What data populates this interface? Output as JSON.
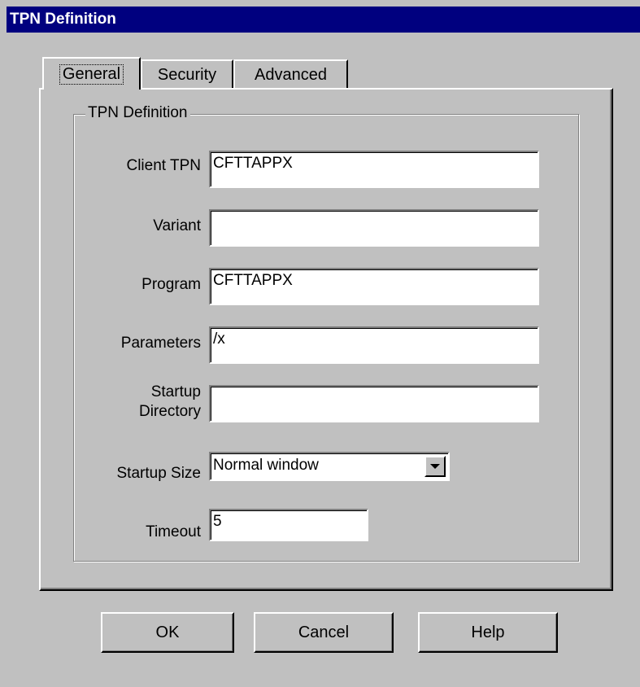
{
  "window": {
    "title": "TPN Definition"
  },
  "tabs": [
    {
      "label": "General",
      "active": true
    },
    {
      "label": "Security",
      "active": false
    },
    {
      "label": "Advanced",
      "active": false
    }
  ],
  "group": {
    "title": "TPN Definition"
  },
  "fields": {
    "client_tpn": {
      "label": "Client TPN",
      "value": "CFTTAPPX"
    },
    "variant": {
      "label": "Variant",
      "value": ""
    },
    "program": {
      "label": "Program",
      "value": "CFTTAPPX"
    },
    "parameters": {
      "label": "Parameters",
      "value": "/x"
    },
    "startup_directory": {
      "label_line1": "Startup",
      "label_line2": "Directory",
      "value": ""
    },
    "startup_size": {
      "label": "Startup Size",
      "value": "Normal window"
    },
    "timeout": {
      "label": "Timeout",
      "value": "5"
    }
  },
  "buttons": {
    "ok": "OK",
    "cancel": "Cancel",
    "help": "Help"
  },
  "colors": {
    "titlebar": "#00007f",
    "face": "#c0c0c0"
  },
  "icons": {
    "combo_arrow": "chevron-down-icon"
  }
}
